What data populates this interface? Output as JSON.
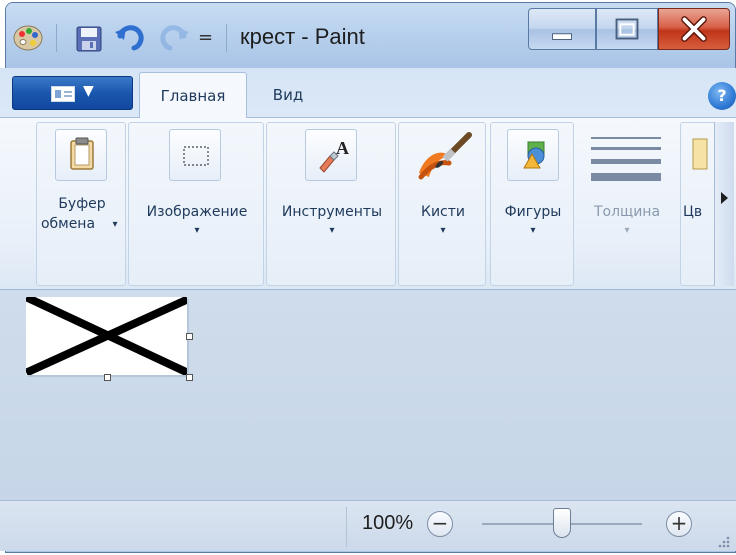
{
  "window": {
    "title": "крест - Paint"
  },
  "quick_access": {
    "icons": [
      "paint-app-icon",
      "save-icon",
      "undo-icon",
      "redo-icon",
      "customize-dropdown-icon"
    ],
    "customize_glyph": "="
  },
  "tabs": [
    {
      "label": "Главная",
      "active": true
    },
    {
      "label": "Вид",
      "active": false
    }
  ],
  "help": {
    "glyph": "?"
  },
  "ribbon": {
    "clipboard": {
      "label_line1": "Буфер",
      "label_line2": "обмена",
      "arrow": "▾",
      "icon": "clipboard-icon"
    },
    "image": {
      "label": "Изображение",
      "arrow": "▾",
      "icon": "select-icon"
    },
    "tools": {
      "label": "Инструменты",
      "arrow": "▾",
      "icon": "tools-icon"
    },
    "brushes": {
      "label": "Кисти",
      "arrow": "▾",
      "icon": "brush-icon"
    },
    "shapes": {
      "label": "Фигуры",
      "arrow": "▾",
      "icon": "shapes-icon"
    },
    "size": {
      "label": "Толщина",
      "arrow": "▾",
      "icon": "line-size-icon"
    },
    "colors": {
      "label": "Цв",
      "icon": "colors-icon"
    }
  },
  "status": {
    "zoom": "100%",
    "zoom_out": "−",
    "zoom_in": "+",
    "zoom_level_percent": 100
  },
  "colors": {
    "file_menu": "#1b57ae",
    "close_button": "#c03519"
  }
}
